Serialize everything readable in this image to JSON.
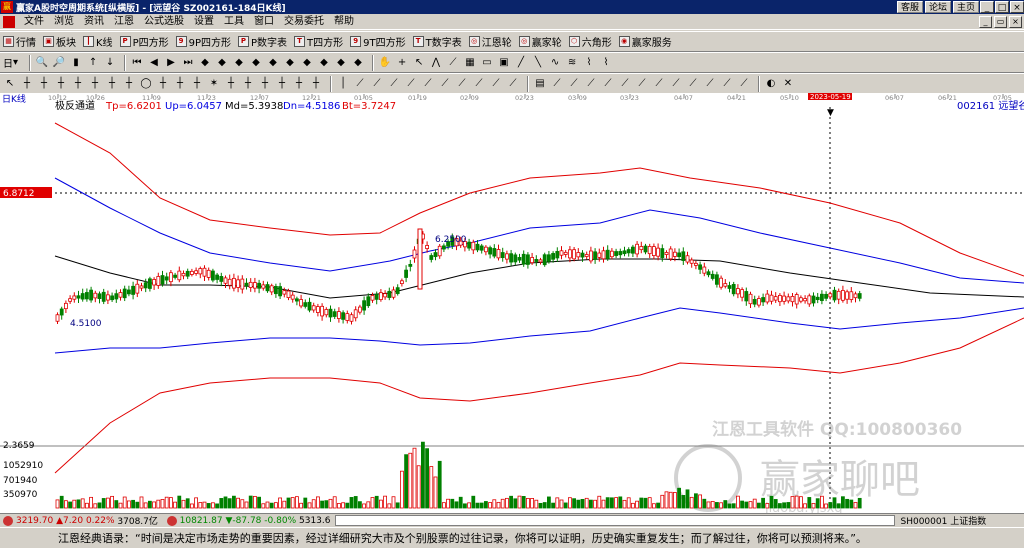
{
  "window": {
    "title": "赢家A股时空周期系统[纵横版] - [远望谷  SZ002161-184日K线]",
    "links": [
      "客服",
      "论坛",
      "主页"
    ]
  },
  "menu": [
    "文件",
    "浏览",
    "资讯",
    "江恩",
    "公式选股",
    "设置",
    "工具",
    "窗口",
    "交易委托",
    "帮助"
  ],
  "toolbar1": [
    {
      "icon": "grid-icon",
      "label": "行情"
    },
    {
      "icon": "block-icon",
      "label": "板块"
    },
    {
      "icon": "kline-icon",
      "label": "K线"
    },
    {
      "icon": "p-icon",
      "label": "P四方形"
    },
    {
      "icon": "9p-icon",
      "label": "9P四方形"
    },
    {
      "icon": "p-icon",
      "label": "P数字表"
    },
    {
      "icon": "t-icon",
      "label": "T四方形"
    },
    {
      "icon": "9t-icon",
      "label": "9T四方形"
    },
    {
      "icon": "t-icon",
      "label": "T数字表"
    },
    {
      "icon": "wheel-icon",
      "label": "江恩轮"
    },
    {
      "icon": "wheel-icon",
      "label": "赢家轮"
    },
    {
      "icon": "hexagon-icon",
      "label": "六角形"
    },
    {
      "icon": "service-icon",
      "label": "赢家服务"
    }
  ],
  "period": "日",
  "chart_header": {
    "period_label": "日K线",
    "indicator_name": "极反通道",
    "tp": "Tp=6.6201",
    "up": "Up=6.0457",
    "md": "Md=5.3938",
    "dn": "Dn=4.5186",
    "bt": "Bt=3.7247",
    "stock": "002161  远望谷",
    "price_marker": "6.8712",
    "high_label": "6.2500",
    "low_label": "4.5100",
    "volume_scale": [
      "2.3659",
      "1052910",
      "701940",
      "350970"
    ],
    "watermark_line1": "江恩工具软件  QQ:100800360",
    "watermark_line2": "赢家聊吧",
    "watermark_line3": "jiaoba.yjsxq"
  },
  "dates": [
    "10-12",
    "10-26",
    "11-09",
    "11-23",
    "12-07",
    "12-21",
    "01-05",
    "01-19",
    "02-09",
    "02-23",
    "03-09",
    "03-23",
    "04-07",
    "04-21",
    "05-10",
    "2023-05-19",
    "06-07",
    "06-21",
    "07-05"
  ],
  "status": {
    "sh": "3219.70",
    "sh_chg": "▲7.20",
    "sh_pct": "0.22%",
    "sh_vol": "3708.7亿",
    "sz": "10821.87",
    "sz_chg": "▼-87.78",
    "sz_pct": "-0.80%",
    "sz_vol": "5313.6",
    "ticker": "SH000001 上证指数"
  },
  "quote": "江恩经典语录：“时间是决定市场走势的重要因素，经过详细研究大市及个别股票的过往记录，你将可以证明，历史确实重复发生；而了解过往，你将可以预测将来。”。",
  "colors": {
    "title_bg": "#0a246a",
    "up_candle": "#e00000",
    "down_candle": "#008000",
    "outer_band": "#e00000",
    "inner_band": "#0000e0",
    "mid_line": "#000000"
  }
}
